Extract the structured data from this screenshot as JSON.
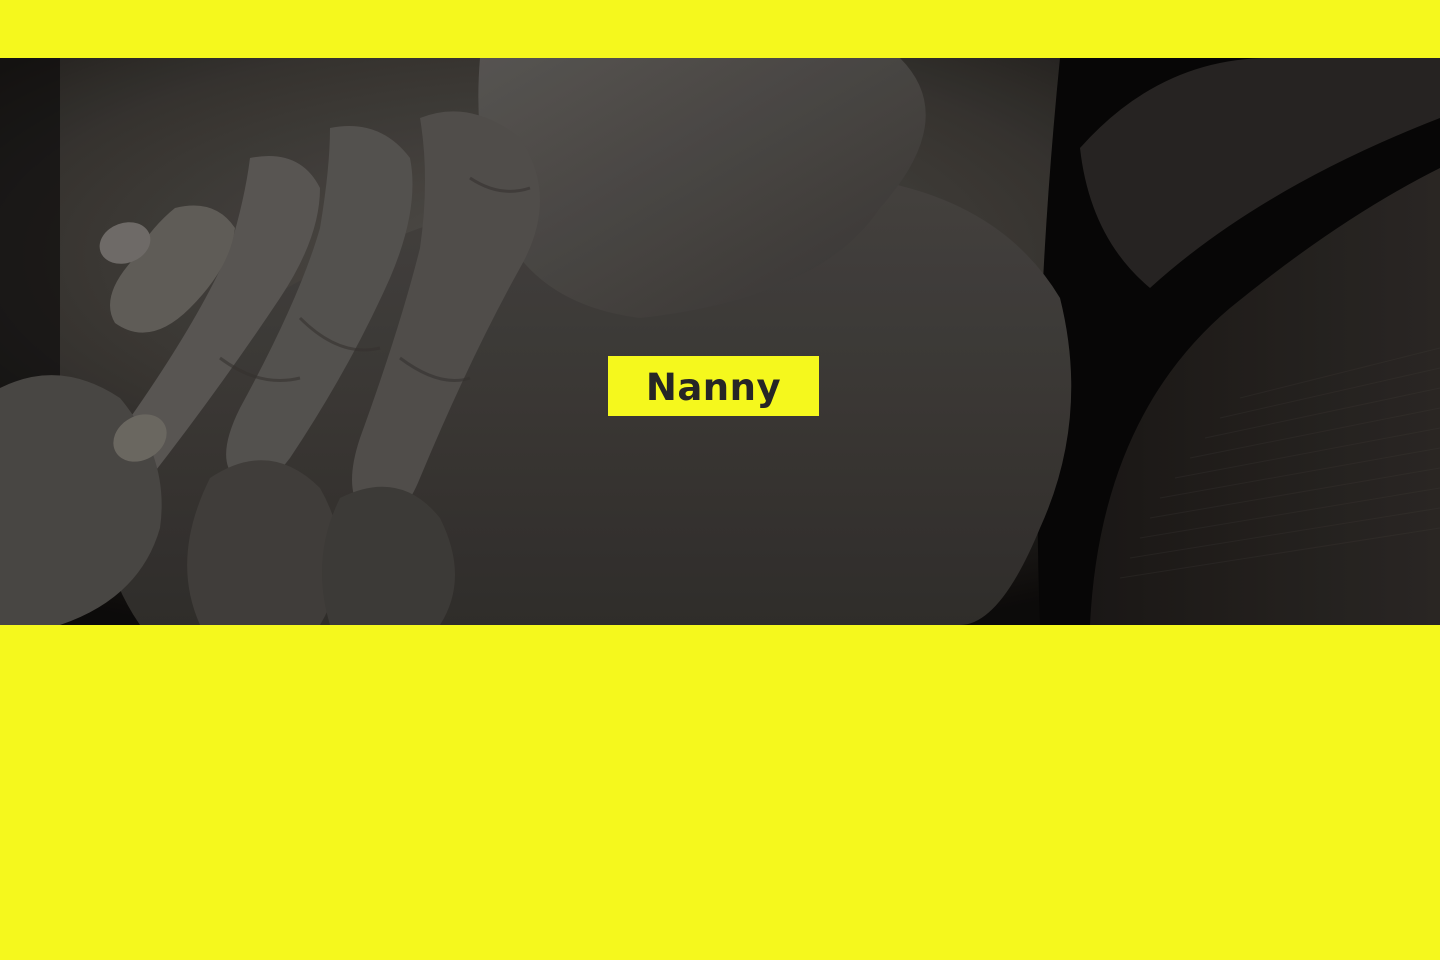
{
  "hero": {
    "label": "Nanny",
    "image_subject": "baby-hand-holding-adult-hand-photo"
  },
  "colors": {
    "accent": "#f5f81d",
    "label_text": "#262626",
    "photo_dark": "#1a1816"
  }
}
